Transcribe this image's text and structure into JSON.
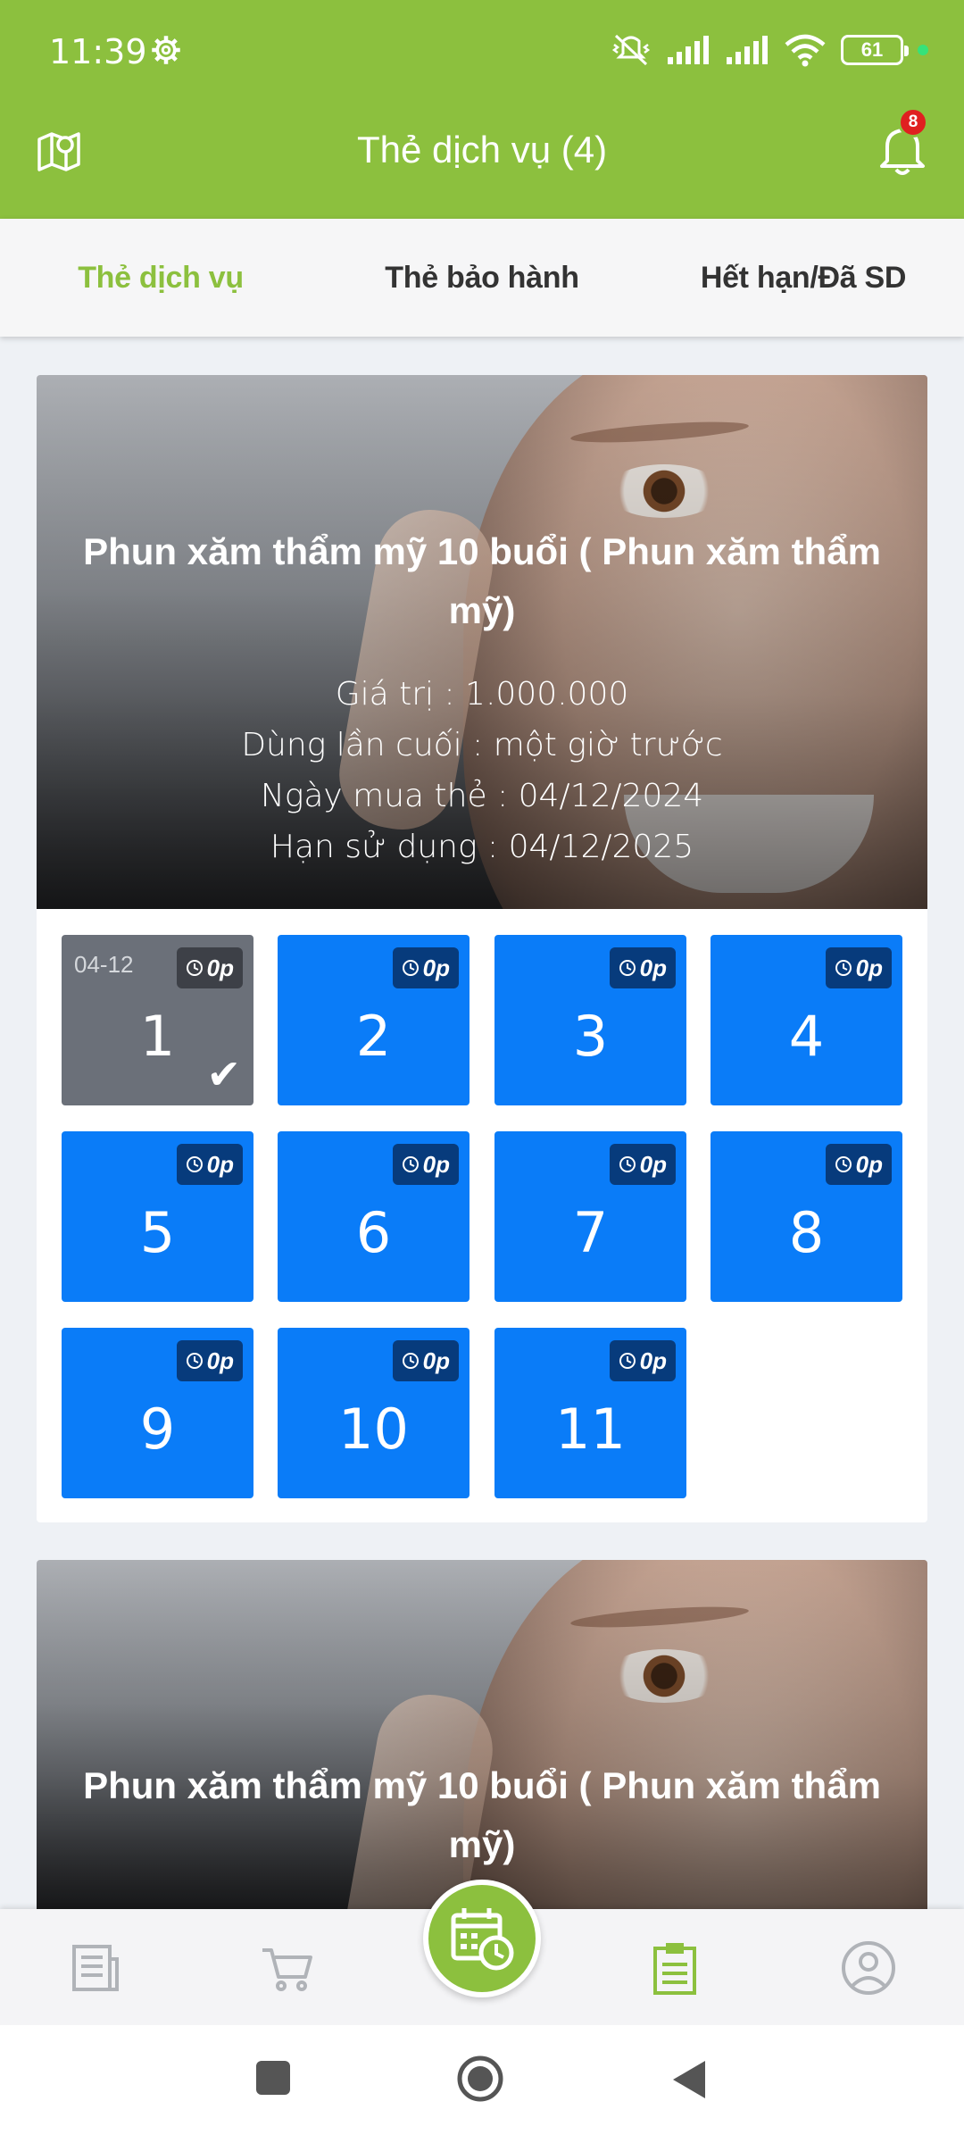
{
  "status_bar": {
    "time": "11:39",
    "battery": "61"
  },
  "header": {
    "title": "Thẻ dịch vụ (4)",
    "notification_count": "8"
  },
  "tabs": [
    {
      "label": "Thẻ dịch vụ",
      "active": true
    },
    {
      "label": "Thẻ bảo hành",
      "active": false
    },
    {
      "label": "Hết hạn/Đã SD",
      "active": false
    }
  ],
  "cards": [
    {
      "name": "Phun xăm thẩm mỹ 10 buổi ( Phun xăm thẩm mỹ)",
      "value_line": "Giá trị : 1.000.000",
      "last_used_line": "Dùng lần cuối : một giờ trước",
      "purchase_line": "Ngày mua thẻ : 04/12/2024",
      "expiry_line": "Hạn sử dụng : 04/12/2025",
      "sessions": [
        {
          "number": "1",
          "duration": "0p",
          "used": true,
          "date": "04-12"
        },
        {
          "number": "2",
          "duration": "0p",
          "used": false
        },
        {
          "number": "3",
          "duration": "0p",
          "used": false
        },
        {
          "number": "4",
          "duration": "0p",
          "used": false
        },
        {
          "number": "5",
          "duration": "0p",
          "used": false
        },
        {
          "number": "6",
          "duration": "0p",
          "used": false
        },
        {
          "number": "7",
          "duration": "0p",
          "used": false
        },
        {
          "number": "8",
          "duration": "0p",
          "used": false
        },
        {
          "number": "9",
          "duration": "0p",
          "used": false
        },
        {
          "number": "10",
          "duration": "0p",
          "used": false
        },
        {
          "number": "11",
          "duration": "0p",
          "used": false
        }
      ]
    },
    {
      "name": "Phun xăm thẩm mỹ 10 buổi ( Phun xăm thẩm mỹ)"
    }
  ],
  "colors": {
    "brand": "#8cc03e",
    "session_available": "#0a7cf8",
    "session_used": "#6b7079"
  },
  "bottom_nav": [
    "news-icon",
    "cart-icon",
    "calendar-clock-icon",
    "clipboard-icon",
    "account-icon"
  ]
}
